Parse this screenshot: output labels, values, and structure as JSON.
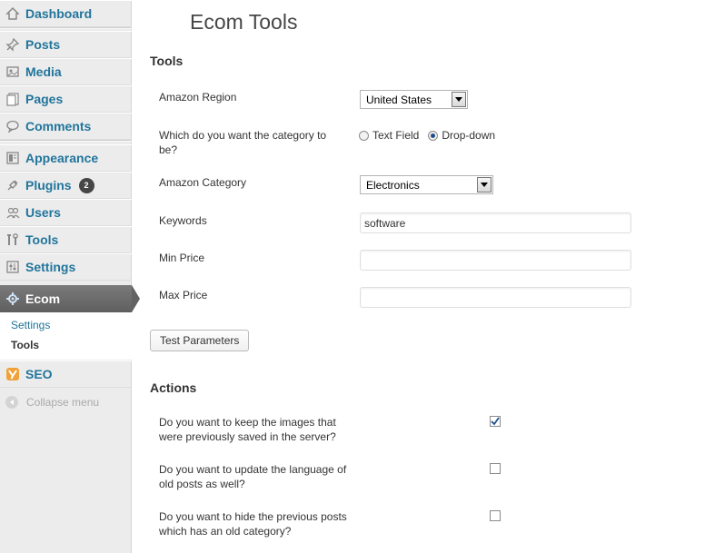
{
  "sidebar": {
    "items": [
      {
        "label": "Dashboard",
        "icon": "dashboard-icon"
      },
      {
        "label": "Posts",
        "icon": "pushpin-icon"
      },
      {
        "label": "Media",
        "icon": "media-icon"
      },
      {
        "label": "Pages",
        "icon": "pages-icon"
      },
      {
        "label": "Comments",
        "icon": "comment-bubble-icon"
      },
      {
        "label": "Appearance",
        "icon": "appearance-icon"
      },
      {
        "label": "Plugins",
        "icon": "plug-icon",
        "badge": "2"
      },
      {
        "label": "Users",
        "icon": "users-icon"
      },
      {
        "label": "Tools",
        "icon": "tools-icon"
      },
      {
        "label": "Settings",
        "icon": "settings-icon"
      },
      {
        "label": "Ecom",
        "icon": "gear-icon"
      },
      {
        "label": "SEO",
        "icon": "seo-logo-icon"
      }
    ],
    "submenu": [
      {
        "label": "Settings"
      },
      {
        "label": "Tools"
      }
    ],
    "collapse_label": "Collapse menu",
    "colors": {
      "link": "#21759b",
      "active_bg": "#6d6d6d",
      "seo": "#f0a23a"
    }
  },
  "main": {
    "title": "Ecom Tools",
    "tools_heading": "Tools",
    "fields": {
      "region_label": "Amazon Region",
      "region_value": "United States",
      "category_type_label": "Which do you want the category to be?",
      "radio_text_field": "Text Field",
      "radio_dropdown": "Drop-down",
      "category_label": "Amazon Category",
      "category_value": "Electronics",
      "keywords_label": "Keywords",
      "keywords_value": "software",
      "min_price_label": "Min Price",
      "min_price_value": "",
      "max_price_label": "Max Price",
      "max_price_value": ""
    },
    "test_button": "Test Parameters",
    "actions_heading": "Actions",
    "actions": [
      {
        "label": "Do you want to keep the images that were previously saved in the server?",
        "checked": true
      },
      {
        "label": "Do you want to update the language of old posts as well?",
        "checked": false
      },
      {
        "label": "Do you want to hide the previous posts which has an old category?",
        "checked": false
      }
    ]
  }
}
